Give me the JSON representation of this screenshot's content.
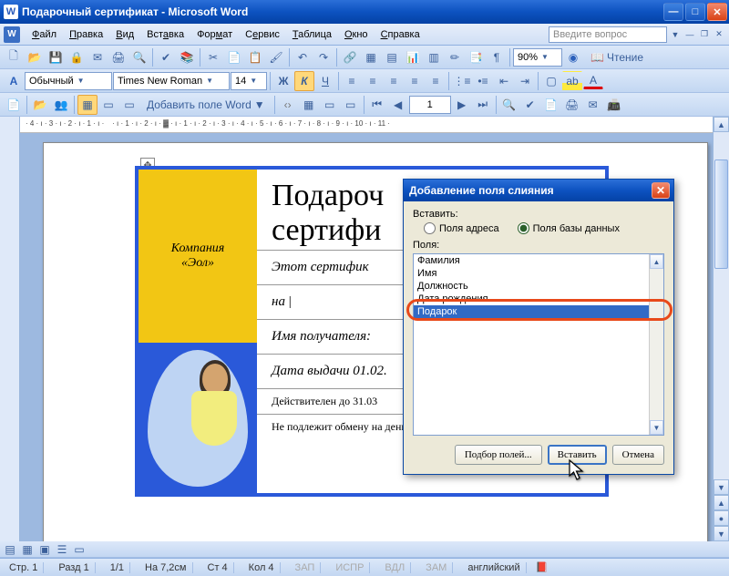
{
  "titlebar": {
    "title": "Подарочный сертификат - Microsoft Word"
  },
  "menu": {
    "items": [
      "Файл",
      "Правка",
      "Вид",
      "Вставка",
      "Формат",
      "Сервис",
      "Таблица",
      "Окно",
      "Справка"
    ],
    "ask_placeholder": "Введите вопрос"
  },
  "toolbar1": {
    "zoom": "90%",
    "reading": "Чтение"
  },
  "toolbar2": {
    "style": "Обычный",
    "font": "Times New Roman",
    "size": "14"
  },
  "toolbar3": {
    "add_field": "Добавить поле Word",
    "recno": "1"
  },
  "document": {
    "company_line1": "Компания",
    "company_line2": "«Эол»",
    "title_line1": "Подароч",
    "title_line2": "сертифи",
    "line_cert": "Этот сертифик",
    "line_on": "на",
    "line_recipient": "Имя получателя:",
    "line_issued": "Дата выдачи 01.02.",
    "line_valid": "Действителен до 31.03",
    "line_noexchange": "Не подлежит обмену на деньги."
  },
  "dialog": {
    "title": "Добавление поля слияния",
    "insert_label": "Вставить:",
    "radio_address": "Поля адреса",
    "radio_db": "Поля базы данных",
    "fields_label": "Поля:",
    "items": [
      "Фамилия",
      "Имя",
      "Должность",
      "Дата рождения",
      "Подарок"
    ],
    "selected_index": 4,
    "btn_match": "Подбор полей...",
    "btn_insert": "Вставить",
    "btn_cancel": "Отмена"
  },
  "statusbar": {
    "page": "Стр. 1",
    "section": "Разд 1",
    "pages": "1/1",
    "at": "На 7,2см",
    "line": "Ст 4",
    "col": "Кол 4",
    "rec": "ЗАП",
    "rev": "ИСПР",
    "ext": "ВДЛ",
    "ovr": "ЗАМ",
    "lang": "английский"
  }
}
